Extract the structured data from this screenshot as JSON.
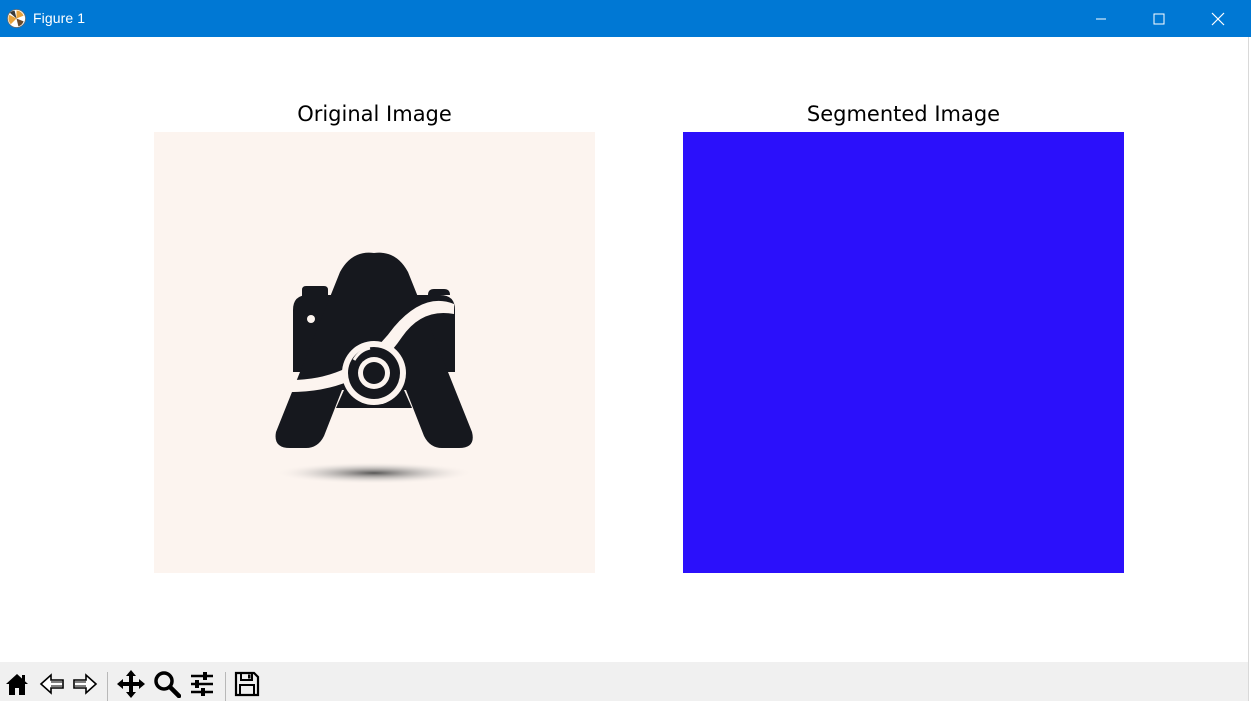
{
  "window": {
    "title": "Figure 1",
    "titlebar_color": "#0078d4",
    "controls": [
      "minimize-icon",
      "maximize-icon",
      "close-icon"
    ]
  },
  "figure": {
    "panels": [
      {
        "title": "Original Image",
        "content": "camera logo with letter A on cream background",
        "background": "#fcf4ef"
      },
      {
        "title": "Segmented Image",
        "fill_color": "#2b10fb"
      }
    ]
  },
  "toolbar": {
    "buttons": [
      "home-icon",
      "back-icon",
      "forward-icon",
      "pan-icon",
      "zoom-icon",
      "configure-subplots-icon",
      "save-icon"
    ]
  }
}
